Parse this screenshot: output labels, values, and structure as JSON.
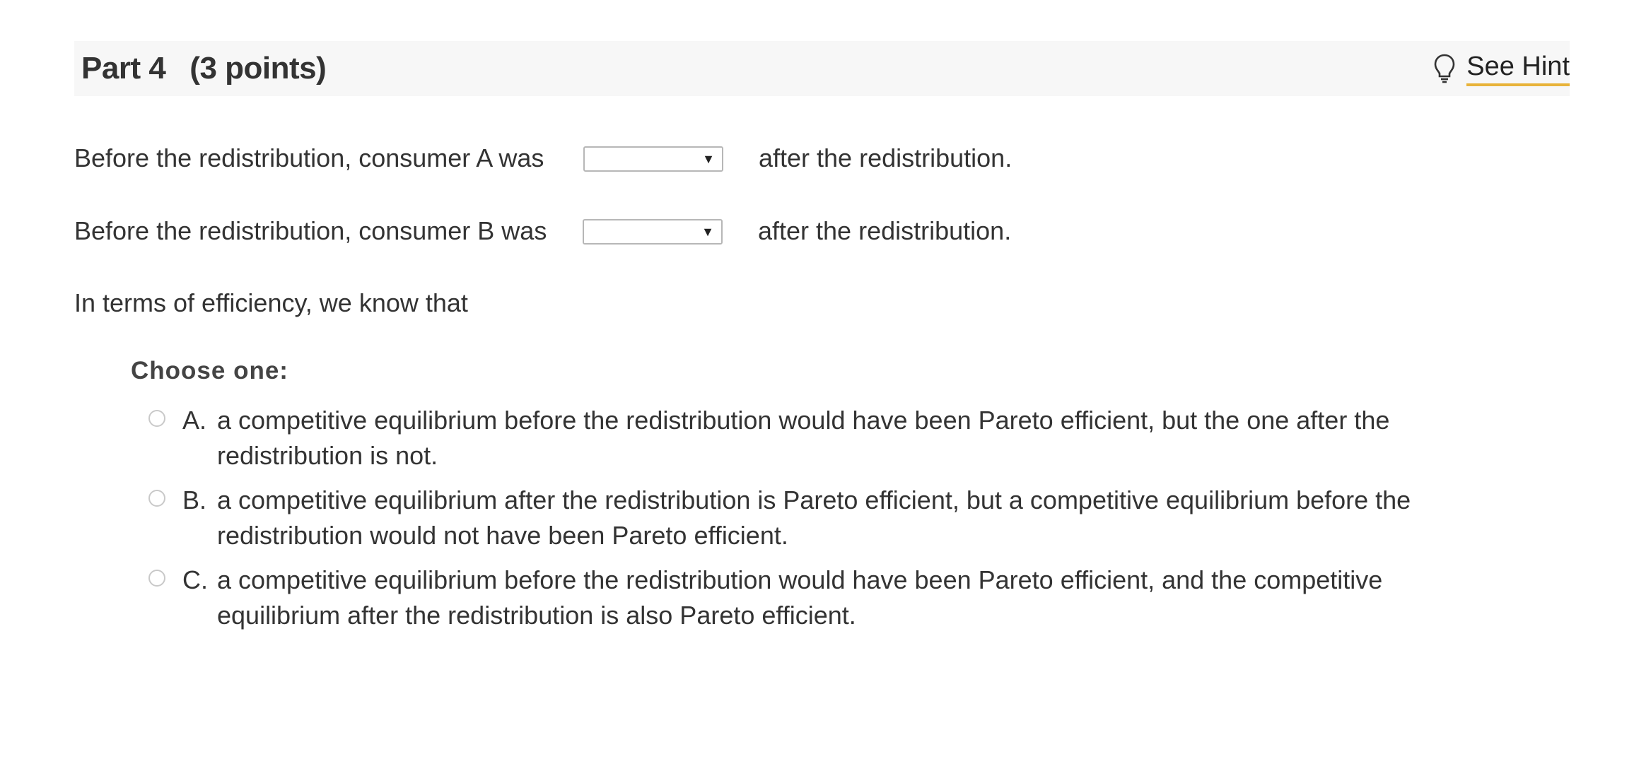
{
  "part": {
    "title": "Part 4",
    "points": "(3 points)",
    "hint_label": "See Hint",
    "hint_icon": "lightbulb-icon"
  },
  "questions": [
    {
      "prefix": "Before the redistribution, consumer A was",
      "select_value": "",
      "suffix": "after the redistribution."
    },
    {
      "prefix": "Before the redistribution, consumer B was",
      "select_value": "",
      "suffix": "after the redistribution."
    }
  ],
  "efficiency_prompt": "In terms of efficiency, we know that",
  "choose_label": "Choose one:",
  "options": [
    {
      "letter": "A.",
      "text": "a competitive equilibrium before the redistribution would have been Pareto efficient, but the one after the redistribution is not.",
      "selected": false
    },
    {
      "letter": "B.",
      "text": "a competitive equilibrium after the redistribution is Pareto efficient, but a competitive equilibrium before the redistribution would not have been Pareto efficient.",
      "selected": false
    },
    {
      "letter": "C.",
      "text": "a competitive equilibrium before the redistribution would have been Pareto efficient, and the competitive equilibrium after the redistribution is also Pareto efficient.",
      "selected": false
    }
  ],
  "colors": {
    "hint_underline": "#e8b33a",
    "header_bg": "#f7f7f7",
    "text": "#333333"
  }
}
